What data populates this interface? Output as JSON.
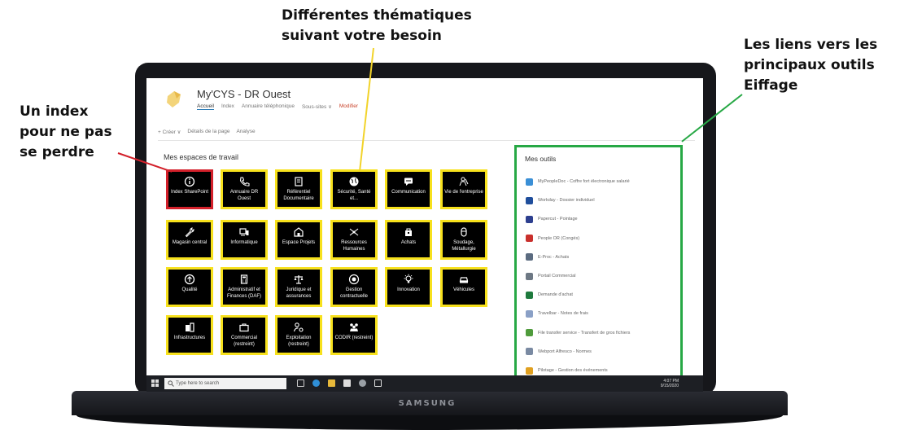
{
  "annotations": {
    "themes": "Différentes thématiques\nsuivant votre besoin",
    "index": "Un index\npour ne pas\nse perdre",
    "links": "Les liens vers les\nprincipaux outils\nEiffage"
  },
  "device_brand": "SAMSUNG",
  "site": {
    "title": "My'CYS - DR Ouest",
    "nav": [
      "Accueil",
      "Index",
      "Annuaire téléphonique",
      "Sous-sites ∨",
      "Modifier"
    ],
    "toolbar": [
      "+ Créer ∨",
      "Détails de la page",
      "Analyse"
    ]
  },
  "workspaces_title": "Mes espaces de travail",
  "tiles": [
    {
      "label": "Index SharePoint",
      "icon": "info-icon"
    },
    {
      "label": "Annuaire DR Ouest",
      "icon": "phone-icon"
    },
    {
      "label": "Référentiel Documentaire",
      "icon": "document-icon"
    },
    {
      "label": "Sécurité, Santé et...",
      "icon": "globe-icon"
    },
    {
      "label": "Communication",
      "icon": "chat-icon"
    },
    {
      "label": "Vie de l'entreprise",
      "icon": "people-icon"
    },
    {
      "label": "Magasin central",
      "icon": "wrench-icon"
    },
    {
      "label": "Informatique",
      "icon": "devices-icon"
    },
    {
      "label": "Espace Projets",
      "icon": "building-icon"
    },
    {
      "label": "Ressources Humaines",
      "icon": "network-icon"
    },
    {
      "label": "Achats",
      "icon": "bag-icon"
    },
    {
      "label": "Soudage, Métallurgie",
      "icon": "cylinder-icon"
    },
    {
      "label": "Qualité",
      "icon": "arrow-up-icon"
    },
    {
      "label": "Administratif et Finances (DAF)",
      "icon": "calculator-icon"
    },
    {
      "label": "Juridique et assurances",
      "icon": "scales-icon"
    },
    {
      "label": "Gestion contractuelle",
      "icon": "target-icon"
    },
    {
      "label": "Innovation",
      "icon": "lightbulb-icon"
    },
    {
      "label": "Véhicules",
      "icon": "car-icon"
    },
    {
      "label": "Infrastructures",
      "icon": "city-icon"
    },
    {
      "label": "Commercial (restreint)",
      "icon": "briefcase-icon"
    },
    {
      "label": "Exploitation (restreint)",
      "icon": "person-gear-icon"
    },
    {
      "label": "CODIR (restreint)",
      "icon": "group-icon"
    }
  ],
  "tools_title": "Mes outils",
  "tools": [
    {
      "label": "MyPeopleDoc - Coffre fort électronique salarié",
      "color": "#3a8fd6"
    },
    {
      "label": "Workday - Dossier individuel",
      "color": "#1f4e9c"
    },
    {
      "label": "Papercut - Pointage",
      "color": "#2d3f8f"
    },
    {
      "label": "People OR (Congés)",
      "color": "#c9302c"
    },
    {
      "label": "E-Proc - Achats",
      "color": "#5b6b80"
    },
    {
      "label": "Portail Commercial",
      "color": "#6d7884"
    },
    {
      "label": "Demande d'achat",
      "color": "#1e7a3d"
    },
    {
      "label": "Travelbar - Notes de frais",
      "color": "#8aa0c6"
    },
    {
      "label": "File transfer service - Transfert de gros fichiers",
      "color": "#4f9b3c"
    },
    {
      "label": "Webport Alfresco - Normes",
      "color": "#7a8aa2"
    },
    {
      "label": "Pilotage - Gestion des événements",
      "color": "#e0a020"
    }
  ],
  "taskbar": {
    "search_placeholder": "Type here to search",
    "time": "4:07 PM",
    "date": "9/15/2020"
  },
  "colors": {
    "tile_border_yellow": "#f7e11c",
    "index_border_red": "#d3202a",
    "tools_border_green": "#27a845"
  }
}
